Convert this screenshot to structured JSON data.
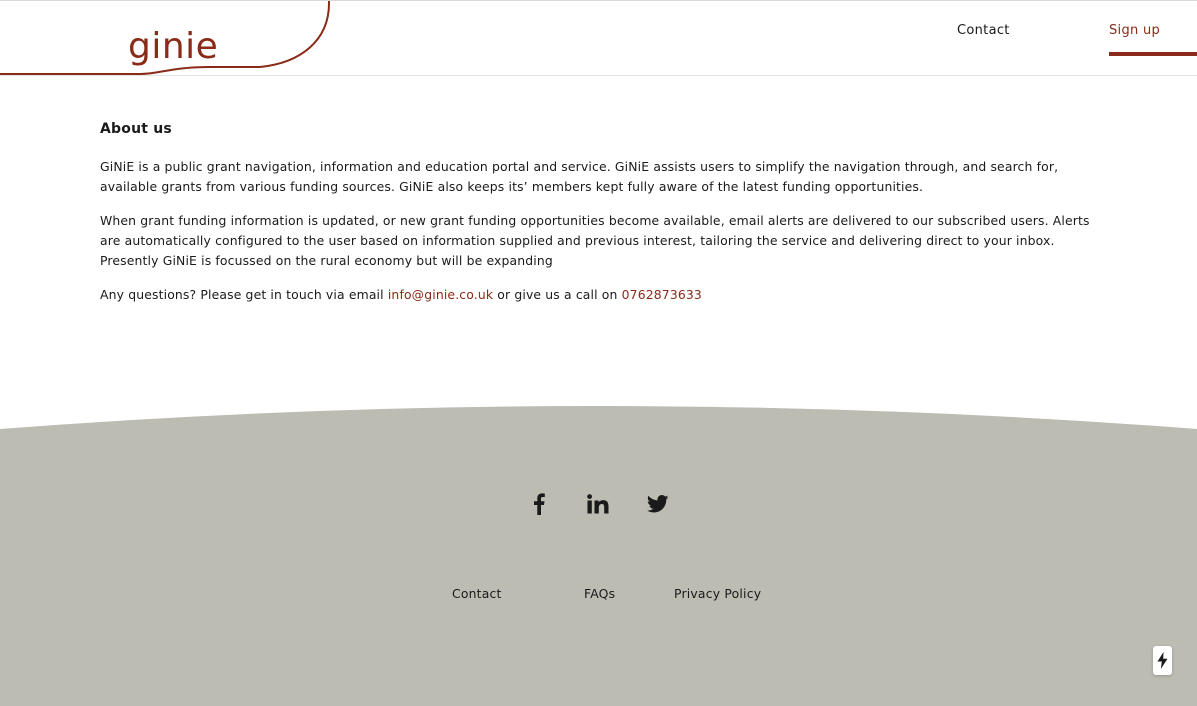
{
  "colors": {
    "brand": "#8a2a18",
    "footer_bg": "#bcbcb3",
    "text": "#1a1a1a"
  },
  "header": {
    "logo_text": "ginie",
    "nav": {
      "contact_label": "Contact",
      "signup_label": "Sign up"
    }
  },
  "about": {
    "heading": "About us",
    "paragraph_1": "GiNiE is a public grant navigation, information and education portal and service. GiNiE assists users to simplify the navigation through, and search for, available grants from various funding sources. GiNiE also keeps its’ members kept fully aware of the latest funding opportunities.",
    "paragraph_2": "When grant funding information is updated, or new grant funding opportunities become available, email alerts are delivered to our subscribed users. Alerts are automatically configured to the user based on information supplied and previous interest, tailoring the service and delivering direct to your inbox. Presently GiNiE is focussed on the rural economy but will be expanding",
    "contact_prefix": "Any questions? Please get in touch via email ",
    "email": "info@ginie.co.uk",
    "contact_middle": " or give us a call on ",
    "phone": "0762873633"
  },
  "footer": {
    "social": [
      {
        "icon": "facebook-icon"
      },
      {
        "icon": "linkedin-icon"
      },
      {
        "icon": "twitter-icon"
      }
    ],
    "links": {
      "contact": "Contact",
      "faqs": "FAQs",
      "privacy": "Privacy Policy"
    }
  },
  "widget": {
    "icon": "lightning-bolt-icon"
  }
}
